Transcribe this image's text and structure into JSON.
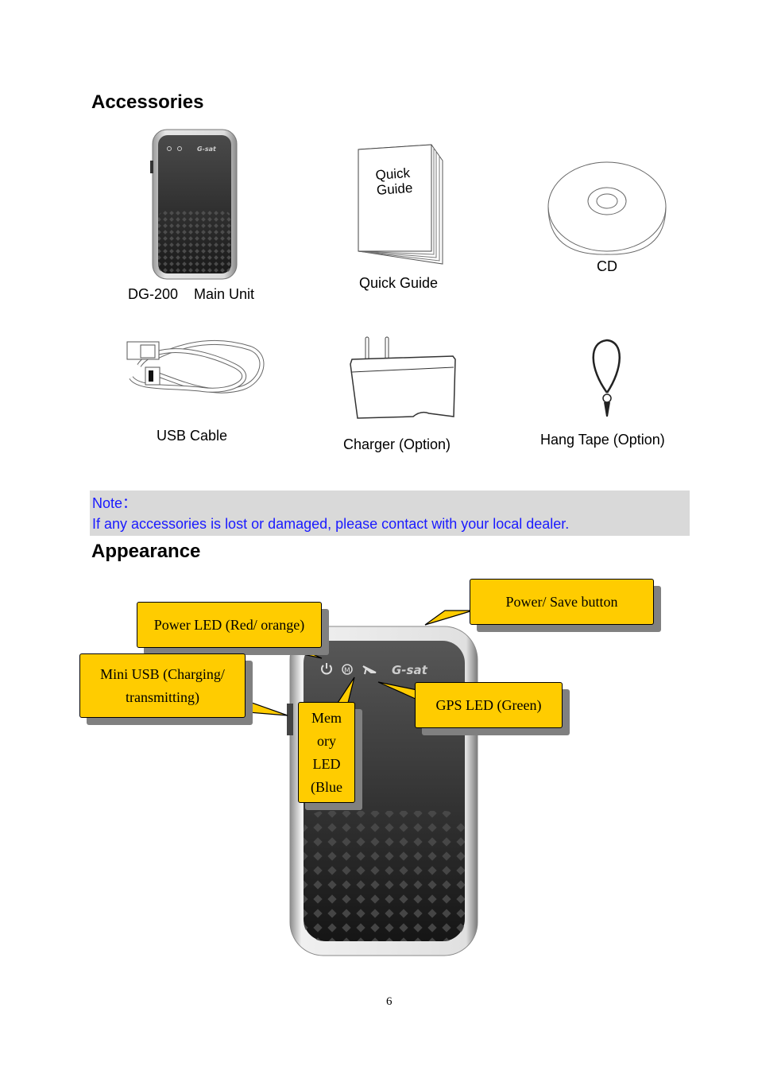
{
  "sections": {
    "accessories_title": "Accessories",
    "appearance_title": "Appearance"
  },
  "accessories": [
    {
      "label": "DG-200    Main Unit",
      "icon": "gps-device"
    },
    {
      "label": "Quick Guide",
      "icon": "booklet",
      "cover_text": [
        "Quick",
        "Guide"
      ]
    },
    {
      "label": "CD",
      "icon": "cd-disc"
    },
    {
      "label": "USB Cable",
      "icon": "usb-cable"
    },
    {
      "label": "Charger (Option)",
      "icon": "charger"
    },
    {
      "label": "Hang Tape (Option)",
      "icon": "hang-tape"
    }
  ],
  "note": {
    "title": "Note：",
    "text": "If any accessories is lost or damaged, please contact with your local dealer.",
    "color": "#1a1aff",
    "background": "#d9d9d9"
  },
  "appearance": {
    "device_brand": "G-sat",
    "callouts": {
      "power_led": "Power LED (Red/ orange)",
      "power_save_button": "Power/ Save button",
      "mini_usb_line1": "Mini USB (Charging/",
      "mini_usb_line2": "transmitting)",
      "memory_led": [
        "Mem",
        "ory",
        "LED",
        "(Blue"
      ],
      "gps_led": "GPS LED (Green)"
    },
    "callout_color": "#ffcc00"
  },
  "page_number": "6"
}
